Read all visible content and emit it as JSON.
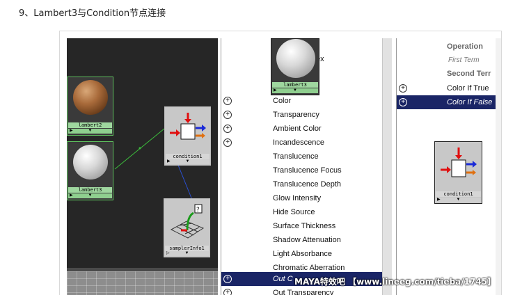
{
  "step_title": "9、Lambert3与Condition节点连接",
  "graph": {
    "nodes": {
      "lambert2": "lambert2",
      "lambert3": "lambert3",
      "condition": "condition1",
      "sampler": "samplerInfo1",
      "drag_lambert3": "lambert3"
    }
  },
  "attribute_list": {
    "partial_top_1": "t",
    "partial_top_2": "ex",
    "items": [
      {
        "label": "Color",
        "expandable": true
      },
      {
        "label": "Transparency",
        "expandable": true
      },
      {
        "label": "Ambient Color",
        "expandable": true
      },
      {
        "label": "Incandescence",
        "expandable": true
      },
      {
        "label": "Translucence",
        "expandable": false
      },
      {
        "label": "Translucence Focus",
        "expandable": false
      },
      {
        "label": "Translucence Depth",
        "expandable": false
      },
      {
        "label": "Glow Intensity",
        "expandable": false
      },
      {
        "label": "Hide Source",
        "expandable": false
      },
      {
        "label": "Surface Thickness",
        "expandable": false
      },
      {
        "label": "Shadow Attenuation",
        "expandable": false
      },
      {
        "label": "Light Absorbance",
        "expandable": false
      },
      {
        "label": "Chromatic Aberration",
        "expandable": false
      }
    ],
    "selected_partial": "Out C",
    "bottom_partial": "Out Transparency"
  },
  "right_panel": {
    "operation": "Operation",
    "first_term": "First Term",
    "second_term": "Second Terr",
    "color_if_true": "Color If True",
    "color_if_false": "Color If False",
    "condition_label": "condition1"
  },
  "watermark": "MAYA特效吧 【www.lineeg.com/tieba/1745】",
  "colors": {
    "selection": "#1a2566",
    "node_border": "#5ec05e",
    "graph_bg": "#262626"
  }
}
